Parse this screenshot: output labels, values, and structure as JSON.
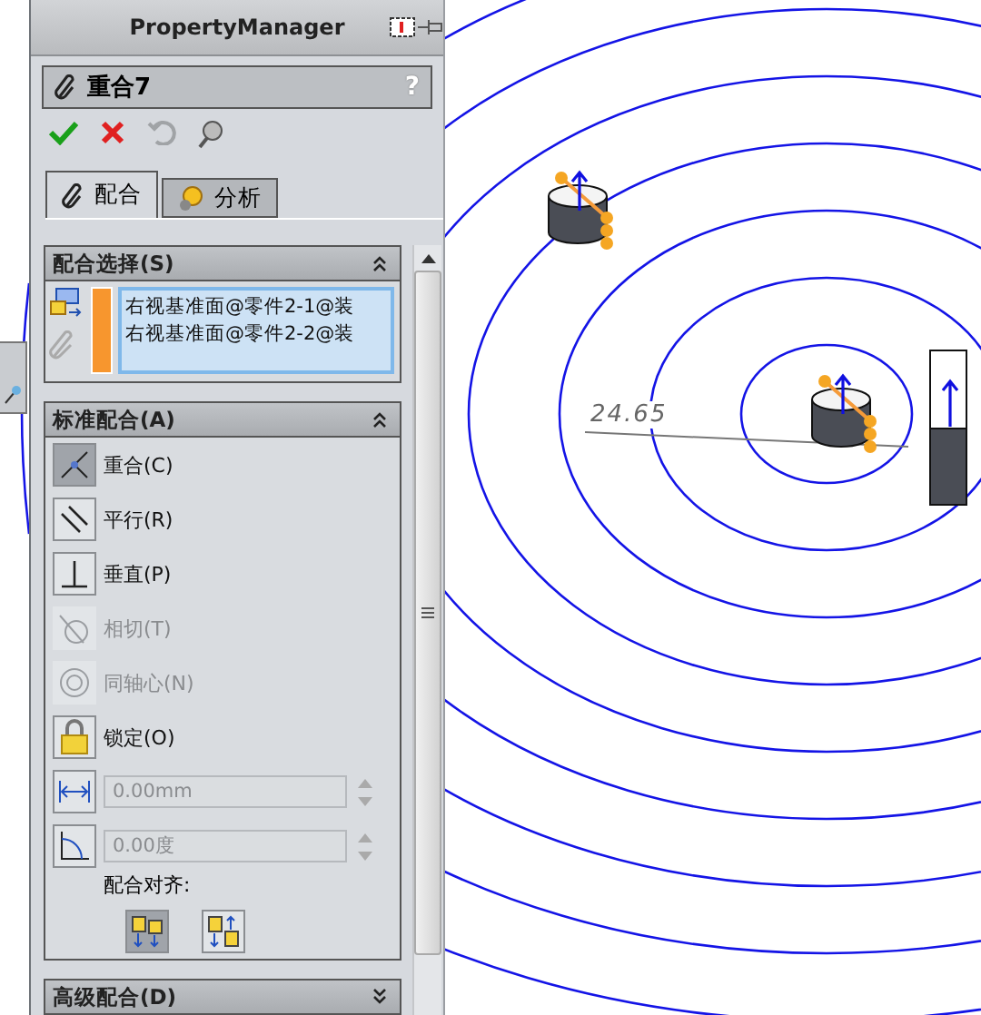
{
  "panel": {
    "title": "PropertyManager",
    "feature_name": "重合7",
    "help": "?"
  },
  "tabs": [
    {
      "label": "配合",
      "selected": true
    },
    {
      "label": "分析",
      "selected": false
    }
  ],
  "mate_selections": {
    "title": "配合选择(S)",
    "expanded": true,
    "items": [
      "右视基准面@零件2-1@装",
      "右视基准面@零件2-2@装"
    ]
  },
  "standard_mates": {
    "title": "标准配合(A)",
    "expanded": true,
    "items": [
      {
        "label": "重合(C)",
        "kind": "coincident",
        "selected": true,
        "disabled": false
      },
      {
        "label": "平行(R)",
        "kind": "parallel",
        "selected": false,
        "disabled": false
      },
      {
        "label": "垂直(P)",
        "kind": "perpendicular",
        "selected": false,
        "disabled": false
      },
      {
        "label": "相切(T)",
        "kind": "tangent",
        "selected": false,
        "disabled": true
      },
      {
        "label": "同轴心(N)",
        "kind": "concentric",
        "selected": false,
        "disabled": true
      },
      {
        "label": "锁定(O)",
        "kind": "lock",
        "selected": false,
        "disabled": false
      }
    ]
  },
  "distance": {
    "value": "0.00mm",
    "disabled": true
  },
  "angle": {
    "value": "0.00度",
    "disabled": true
  },
  "alignment": {
    "label": "配合对齐:",
    "options": [
      {
        "kind": "aligned",
        "selected": true
      },
      {
        "kind": "anti_aligned",
        "selected": false
      }
    ]
  },
  "advanced": {
    "title": "高级配合(D)",
    "expanded": false
  },
  "viewport": {
    "dimension": "24.65"
  }
}
